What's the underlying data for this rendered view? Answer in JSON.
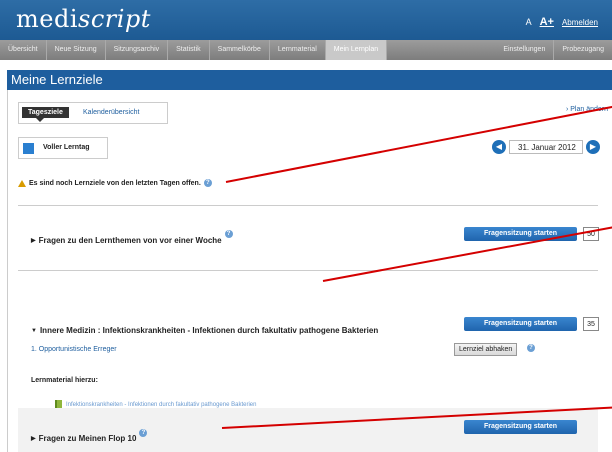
{
  "header": {
    "logo_regular": "medi",
    "logo_italic": "script",
    "font_small": "A",
    "font_large": "A+",
    "logout": "Abmelden"
  },
  "nav": {
    "items": [
      "Übersicht",
      "Neue Sitzung",
      "Sitzungsarchiv",
      "Statistik",
      "Sammelkörbe",
      "Lernmaterial",
      "Mein Lernplan"
    ],
    "right_items": [
      "Einstellungen",
      "Probezugang"
    ],
    "active": "Mein Lernplan"
  },
  "page": {
    "title": "Meine Lernziele"
  },
  "tabs": {
    "active": "Tagesziele",
    "other": "Kalenderübersicht"
  },
  "plan_link": "› Plan ändern",
  "lerntag": {
    "label": "Voller Lerntag",
    "color": "#2a7fd0"
  },
  "date": {
    "value": "31. Januar 2012",
    "prev": "◀",
    "next": "▶"
  },
  "warning": {
    "text": "Es sind noch Lernziele von den letzten Tagen offen."
  },
  "sections": {
    "week": {
      "title": "Fragen zu den Lernthemen von vor einer Woche",
      "button": "Fragensitzung starten",
      "count": "50"
    },
    "innere": {
      "title": "Innere Medizin : Infektionskrankheiten - Infektionen durch fakultativ pathogene Bakterien",
      "button": "Fragensitzung starten",
      "count": "35",
      "sub_item": "1. Opportunistische Erreger",
      "abhaken": "Lernziel abhaken",
      "lernmaterial_label": "Lernmaterial hierzu:",
      "lernmaterial_link": "Infektionskrankheiten - Infektionen durch fakultativ pathogene Bakterien"
    },
    "flop": {
      "title": "Fragen zu Meinen Flop 10",
      "button": "Fragensitzung starten"
    }
  },
  "colors": {
    "primary": "#1e5e9e",
    "button": "#2a74c0",
    "annotation": "#d40000",
    "warning": "#d89b00"
  }
}
